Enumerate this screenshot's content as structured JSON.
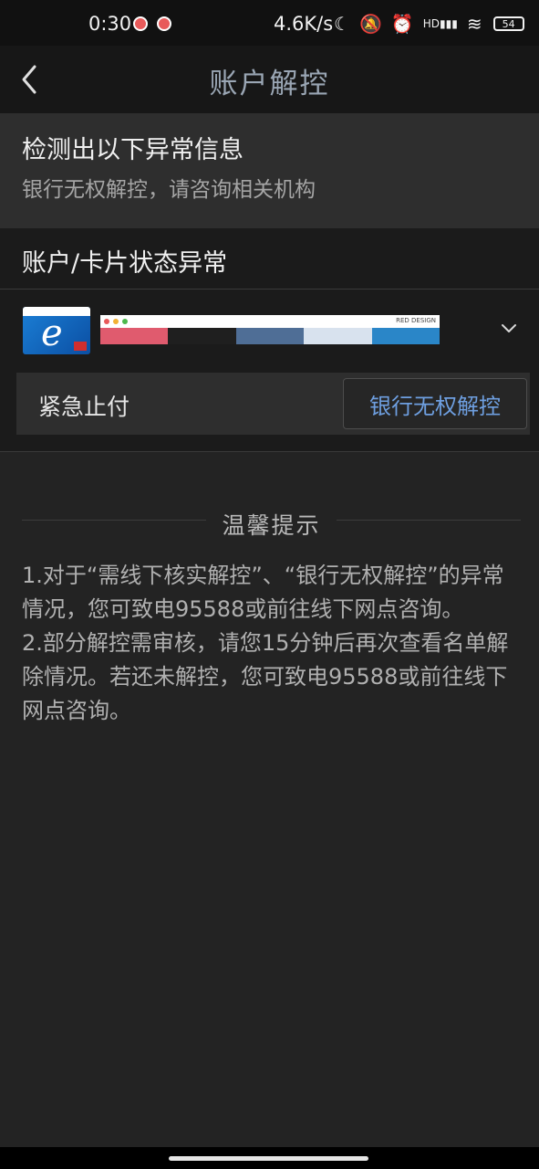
{
  "status_bar": {
    "time": "0:30",
    "net_speed": "4.6K/s",
    "network": "HD",
    "battery": "54",
    "icons": [
      "notification-icon",
      "notification-icon",
      "moon-icon",
      "mute-icon",
      "alarm-icon",
      "signal-icon",
      "wifi-icon",
      "battery-icon"
    ]
  },
  "nav": {
    "title": "账户解控",
    "back_icon": "chevron-left-icon"
  },
  "notice": {
    "title": "检测出以下异常信息",
    "subtitle": "银行无权解控，请咨询相关机构"
  },
  "abnormal": {
    "title": "账户/卡片状态异常",
    "card": {
      "brand_text": "RED DESIGN",
      "palette": [
        "#e05b6e",
        "#1f1f1f",
        "#4f6e96",
        "#d8e2ee",
        "#2a86c8"
      ]
    },
    "row_label": "紧急止付",
    "button_label": "银行无权解控"
  },
  "tips": {
    "title": "温馨提示",
    "line1": "1.对于“需线下核实解控”、“银行无权解控”的异常情况，您可致电95588或前往线下网点咨询。",
    "line2": "2.部分解控需审核，请您15分钟后再次查看名单解除情况。若还未解控，您可致电95588或前往线下网点咨询。"
  },
  "colors": {
    "accent": "#6e9fe0",
    "background": "#232323"
  }
}
